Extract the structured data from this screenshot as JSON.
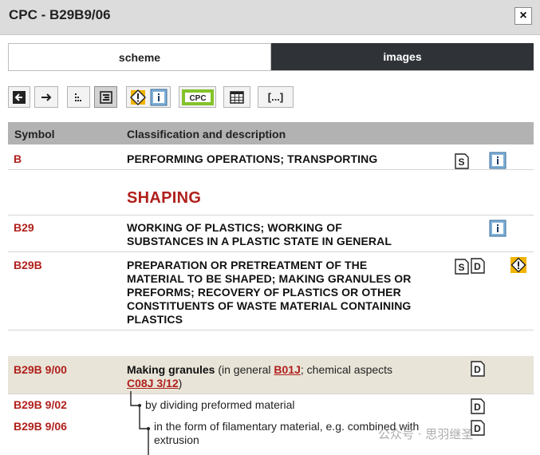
{
  "window": {
    "title": "CPC - B29B9/06",
    "close_label": "×"
  },
  "tabs": [
    {
      "label": "scheme"
    },
    {
      "label": "images"
    }
  ],
  "toolbar": {
    "buttons": [
      {
        "icon": "arrow-left-icon"
      },
      {
        "icon": "arrow-right-icon"
      },
      {
        "icon": "tree-levels-icon"
      },
      {
        "icon": "indent-view-icon",
        "pressed": true
      },
      {
        "icon": "warning-info-icon"
      },
      {
        "icon": "cpc-icon",
        "label": "CPC"
      },
      {
        "icon": "table-grid-icon"
      },
      {
        "icon": "ellipsis-bracket-icon",
        "label": "[...]"
      }
    ]
  },
  "table": {
    "headers": {
      "symbol": "Symbol",
      "description": "Classification and description"
    },
    "rows": [
      {
        "symbol": "B",
        "description": "PERFORMING OPERATIONS; TRANSPORTING"
      },
      {
        "heading": "SHAPING"
      },
      {
        "symbol": "B29",
        "description_lines": [
          "WORKING OF PLASTICS; WORKING OF",
          "SUBSTANCES IN A PLASTIC STATE IN GENERAL"
        ]
      },
      {
        "symbol": "B29B",
        "description_lines": [
          "PREPARATION OR PRETREATMENT OF THE",
          "MATERIAL TO BE SHAPED; MAKING GRANULES OR",
          "PREFORMS; RECOVERY OF PLASTICS OR OTHER",
          "CONSTITUENTS OF WASTE MATERIAL CONTAINING",
          "PLASTICS"
        ]
      },
      {
        "symbol": "B29B 9/00",
        "title": "Making granules",
        "text_1": " (in general ",
        "link_1": "B01J",
        "text_2": "; chemical aspects",
        "link_2": "C08J 3/12",
        "text_3": ")"
      },
      {
        "symbol": "B29B 9/02",
        "description": "by dividing preformed material"
      },
      {
        "symbol": "B29B 9/06",
        "description_lines": [
          "in the form of filamentary material, e.g. combined with",
          "extrusion"
        ]
      }
    ],
    "badge_labels": {
      "s": "S",
      "d": "D",
      "i": "i",
      "warn": "!"
    }
  },
  "colors": {
    "symbol_red": "#b0201c",
    "header_gray": "#b2b2b2",
    "highlight": "#e8e4d8",
    "tab_dark": "#2f3338"
  },
  "watermark": "公众号 · 思羽继圣"
}
